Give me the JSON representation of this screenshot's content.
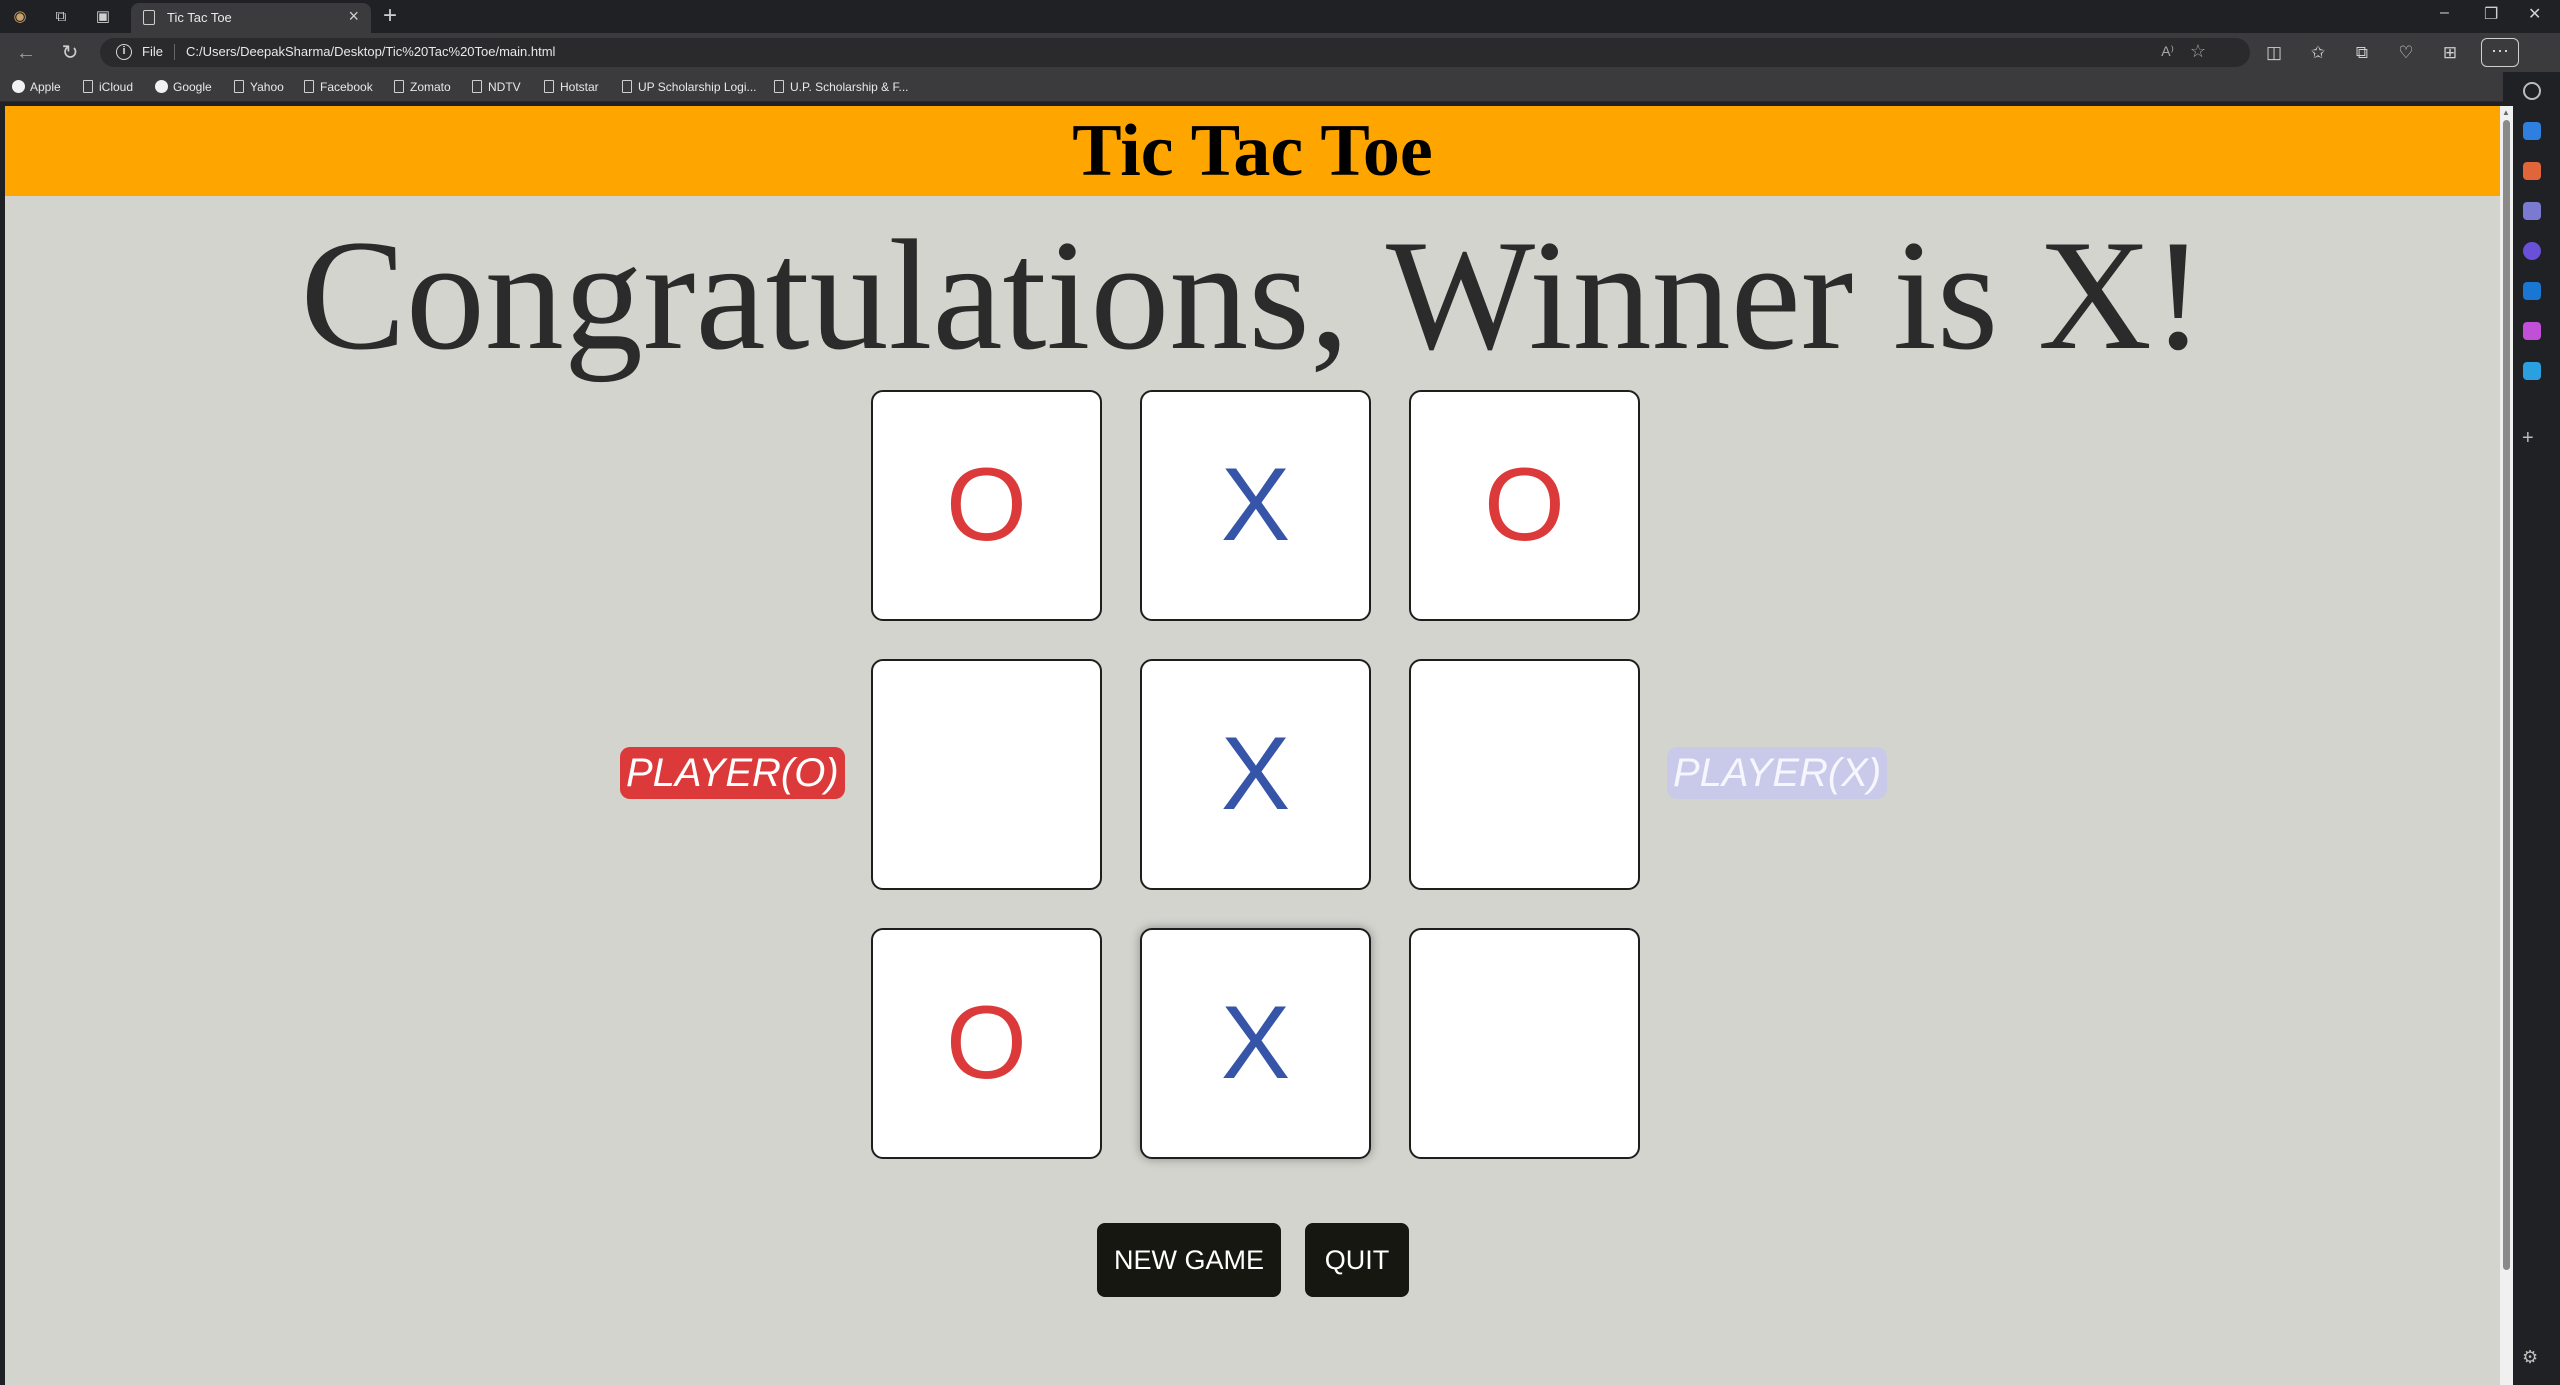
{
  "browser": {
    "tab_title": "Tic Tac Toe",
    "address_scheme": "File",
    "url": "C:/Users/DeepakSharma/Desktop/Tic%20Tac%20Toe/main.html",
    "read_aloud": "A⁾",
    "bookmarks": [
      "Apple",
      "iCloud",
      "Google",
      "Yahoo",
      "Facebook",
      "Zomato",
      "NDTV",
      "Hotstar",
      "UP Scholarship Logi...",
      "U.P. Scholarship & F..."
    ]
  },
  "game": {
    "title": "Tic Tac Toe",
    "status": "Congratulations, Winner is X!",
    "board": [
      "O",
      "X",
      "O",
      "",
      "X",
      "",
      "O",
      "X",
      ""
    ],
    "player_o_label": "PLAYER(O)",
    "player_x_label": "PLAYER(X)",
    "new_game_label": "NEW GAME",
    "quit_label": "QUIT",
    "colors": {
      "header_bg": "#ffa500",
      "page_bg": "#d4d4cf",
      "o_color": "#dc3a3a",
      "x_color": "#3654a8",
      "player_x_bg": "#c9c9e9",
      "button_bg": "#171711"
    }
  }
}
